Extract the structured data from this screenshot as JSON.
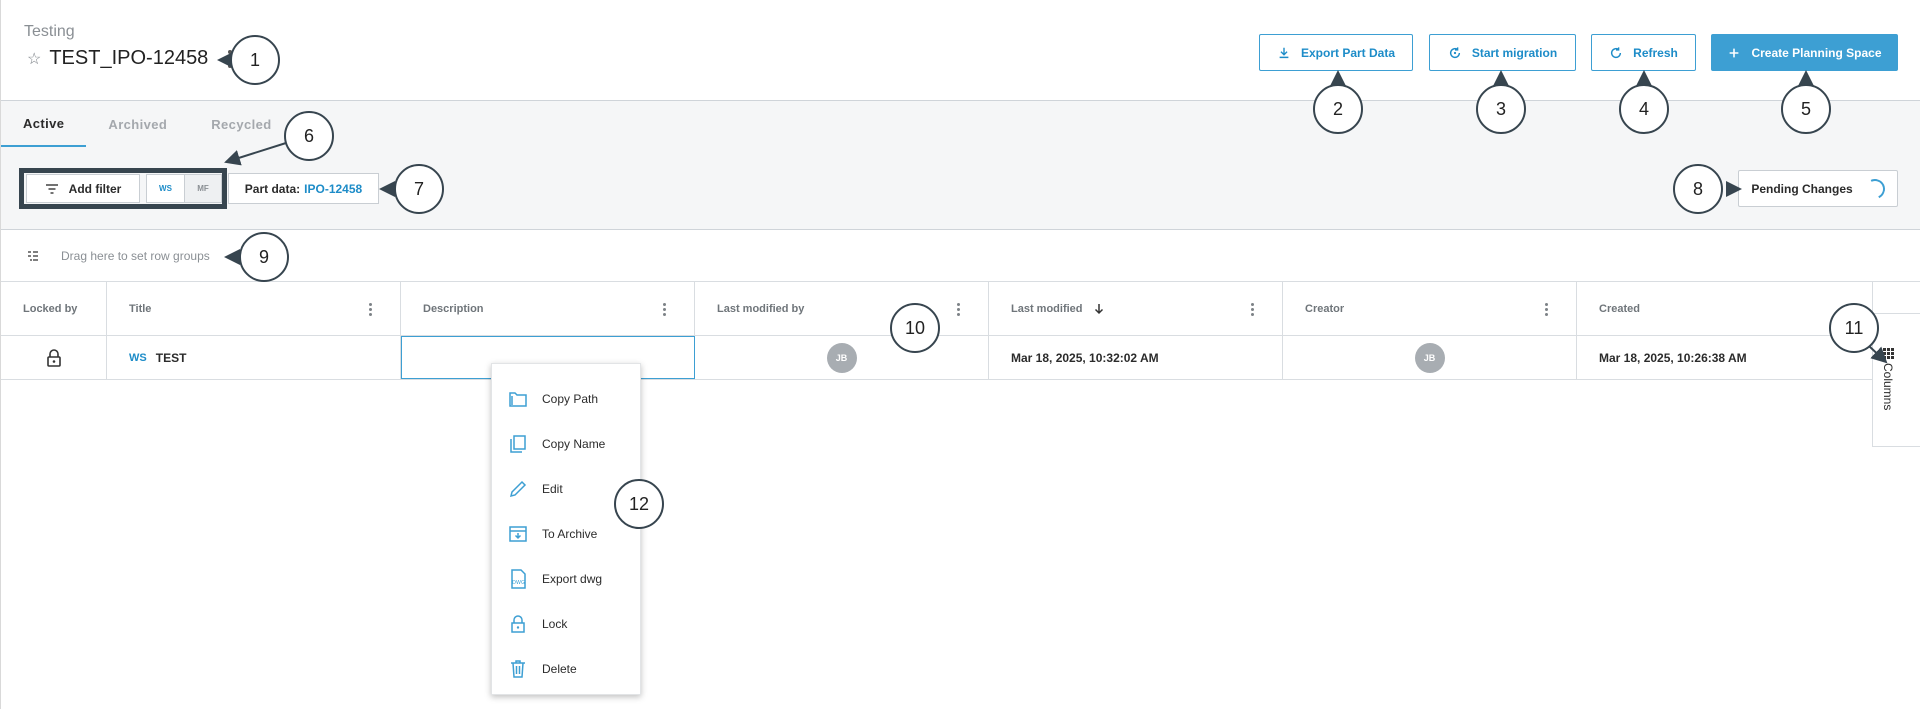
{
  "header": {
    "breadcrumb": "Testing",
    "title": "TEST_IPO-12458",
    "buttons": {
      "export": "Export Part Data",
      "migration": "Start migration",
      "refresh": "Refresh",
      "create": "Create Planning Space"
    }
  },
  "tabs": [
    {
      "label": "Active",
      "active": true
    },
    {
      "label": "Archived",
      "active": false
    },
    {
      "label": "Recycled",
      "active": false
    }
  ],
  "filters": {
    "add_filter": "Add filter",
    "seg_ws": "WS",
    "seg_mf": "MF",
    "part_data_label": "Part data:",
    "part_data_value": "IPO-12458",
    "pending": "Pending Changes"
  },
  "row_groups": {
    "placeholder": "Drag here to set row groups"
  },
  "grid": {
    "columns": [
      "Locked by",
      "Title",
      "Description",
      "Last modified by",
      "Last modified",
      "Creator",
      "Created"
    ],
    "sorted_column": "Last modified",
    "row": {
      "title_tag": "WS",
      "title": "TEST",
      "description": "",
      "last_modified_by": "JB",
      "last_modified": "Mar 18, 2025, 10:32:02 AM",
      "creator": "JB",
      "created": "Mar 18, 2025, 10:26:38 AM"
    }
  },
  "columns_panel": {
    "label": "Columns"
  },
  "context_menu": [
    {
      "label": "Copy Path",
      "icon": "folder-icon"
    },
    {
      "label": "Copy Name",
      "icon": "copy-icon"
    },
    {
      "label": "Edit",
      "icon": "pencil-icon"
    },
    {
      "label": "To Archive",
      "icon": "archive-icon"
    },
    {
      "label": "Export dwg",
      "icon": "dwg-file-icon"
    },
    {
      "label": "Lock",
      "icon": "lock-icon"
    },
    {
      "label": "Delete",
      "icon": "trash-icon"
    }
  ],
  "callouts": [
    "1",
    "2",
    "3",
    "4",
    "5",
    "6",
    "7",
    "8",
    "9",
    "10",
    "11",
    "12"
  ],
  "colors": {
    "accent": "#3d9fd3",
    "dark": "#37454f"
  }
}
